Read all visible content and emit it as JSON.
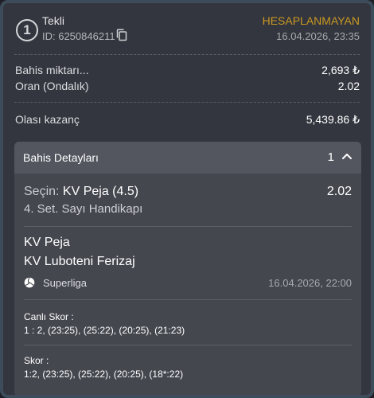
{
  "header": {
    "number": "1",
    "bet_type": "Tekli",
    "id_text": "ID: 6250846211",
    "status": "HESAPLANMAYAN",
    "date": "16.04.2026, 23:35"
  },
  "summary": {
    "stake_label": "Bahis miktarı...",
    "stake_value": "2,693 ₺",
    "odds_label": "Oran (Ondalık)",
    "odds_value": "2.02",
    "payout_label": "Olası kazanç",
    "payout_value": "5,439.86 ₺"
  },
  "details": {
    "title": "Bahis Detayları",
    "count": "1",
    "selection_prefix": "Seçin:",
    "selection": "KV Peja (4.5)",
    "selection_odds": "2.02",
    "market": "4. Set. Sayı Handikapı",
    "home_team": "KV Peja",
    "away_team": "KV Luboteni Ferizaj",
    "league": "Superliga",
    "match_date": "16.04.2026, 22:00",
    "live_score_label": "Canlı Skor :",
    "live_score_value": "1 : 2, (23:25), (25:22), (20:25), (21:23)",
    "score_label": "Skor :",
    "score_value": "1:2, (23:25), (25:22), (20:25), (18*:22)"
  },
  "colors": {
    "status": "#c9981f",
    "background": "#34363f",
    "panel": "#45474f",
    "border": "#3d4c5a"
  },
  "icons": {
    "copy": "copy-icon",
    "collapse": "chevron-up-icon",
    "sport": "volleyball-icon"
  }
}
